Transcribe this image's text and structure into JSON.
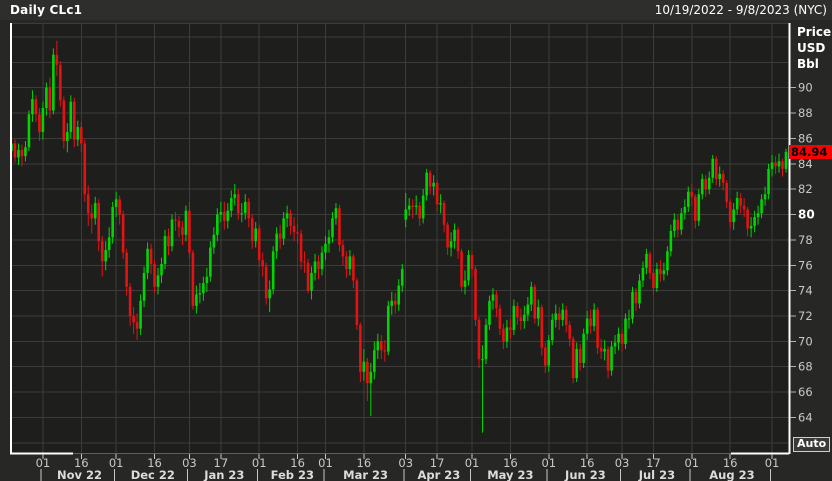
{
  "header": {
    "title": "Daily CLc1",
    "date_range": "10/19/2022 - 9/8/2023 (NYC)"
  },
  "right_axis": {
    "unit_lines": [
      "Price",
      "USD",
      "Bbl"
    ],
    "auto_label": "Auto"
  },
  "chart_data": {
    "type": "candlestick",
    "symbol": "CLc1",
    "interval": "Daily",
    "title": "Daily CLc1",
    "period": "10/19/2022 - 9/8/2023 (NYC)",
    "ylabel": "Price USD Bbl",
    "last_price": 84.94,
    "ylim": [
      61.2,
      95.1
    ],
    "grid_prices": [
      62,
      64,
      66,
      68,
      70,
      72,
      74,
      76,
      78,
      80,
      82,
      84,
      86,
      88,
      90,
      92,
      94
    ],
    "y_labels": [
      90,
      88,
      86,
      84,
      82,
      80,
      78,
      76,
      74,
      72,
      70,
      68,
      66,
      64
    ],
    "y_bold_label": "80",
    "x_ticks": [
      {
        "i": 9,
        "label": "01"
      },
      {
        "i": 20,
        "label": "16"
      },
      {
        "i": 30,
        "label": "01"
      },
      {
        "i": 41,
        "label": "16"
      },
      {
        "i": 51,
        "label": "03"
      },
      {
        "i": 60,
        "label": "17"
      },
      {
        "i": 71,
        "label": "01"
      },
      {
        "i": 82,
        "label": "16"
      },
      {
        "i": 90,
        "label": "01"
      },
      {
        "i": 101,
        "label": "16"
      },
      {
        "i": 113,
        "label": "03"
      },
      {
        "i": 122,
        "label": "17"
      },
      {
        "i": 132,
        "label": "01"
      },
      {
        "i": 143,
        "label": "16"
      },
      {
        "i": 154,
        "label": "01"
      },
      {
        "i": 165,
        "label": "16"
      },
      {
        "i": 175,
        "label": "03"
      },
      {
        "i": 184,
        "label": "17"
      },
      {
        "i": 195,
        "label": "01"
      },
      {
        "i": 206,
        "label": "16"
      },
      {
        "i": 218,
        "label": "01"
      }
    ],
    "month_boundaries": [
      9,
      30,
      51,
      71,
      90,
      113,
      132,
      154,
      175,
      195,
      218
    ],
    "months": [
      {
        "start": 9,
        "end": 30,
        "label": "Nov 22"
      },
      {
        "start": 30,
        "end": 51,
        "label": "Dec 22"
      },
      {
        "start": 51,
        "end": 71,
        "label": "Jan 23"
      },
      {
        "start": 71,
        "end": 90,
        "label": "Feb 23"
      },
      {
        "start": 90,
        "end": 113,
        "label": "Mar 23"
      },
      {
        "start": 113,
        "end": 132,
        "label": "Apr 23"
      },
      {
        "start": 132,
        "end": 154,
        "label": "May 23"
      },
      {
        "start": 154,
        "end": 175,
        "label": "Jun 23"
      },
      {
        "start": 175,
        "end": 195,
        "label": "Jul 23"
      },
      {
        "start": 195,
        "end": 218,
        "label": "Aug 23"
      }
    ],
    "colors": {
      "up": "#00d600",
      "down": "#e41212",
      "badge": "#fa0000",
      "plot_bg": "#1e1e1d",
      "grid": "#3c3c3c",
      "outer_bg": "#272726",
      "axis_label": "#c9c9c9",
      "white": "#ffffff"
    },
    "candles": [
      [
        85.0,
        86.0,
        84.3,
        85.6
      ],
      [
        85.6,
        85.9,
        84.1,
        84.5
      ],
      [
        84.5,
        85.6,
        83.9,
        85.1
      ],
      [
        85.1,
        85.5,
        83.8,
        84.6
      ],
      [
        84.6,
        85.8,
        84.2,
        85.3
      ],
      [
        85.3,
        88.2,
        85.0,
        87.9
      ],
      [
        87.9,
        89.8,
        87.3,
        89.1
      ],
      [
        89.1,
        89.4,
        87.3,
        87.9
      ],
      [
        87.9,
        88.4,
        85.8,
        86.5
      ],
      [
        86.5,
        88.9,
        85.9,
        88.4
      ],
      [
        88.4,
        90.4,
        87.8,
        90.0
      ],
      [
        90.0,
        90.8,
        87.6,
        88.2
      ],
      [
        88.2,
        93.1,
        87.9,
        92.6
      ],
      [
        92.6,
        93.7,
        90.9,
        91.8
      ],
      [
        91.8,
        92.1,
        88.5,
        89.0
      ],
      [
        89.0,
        89.3,
        85.2,
        85.8
      ],
      [
        85.8,
        87.2,
        84.9,
        86.5
      ],
      [
        86.5,
        89.4,
        86.0,
        88.9
      ],
      [
        88.9,
        89.2,
        85.3,
        85.9
      ],
      [
        85.9,
        87.4,
        85.4,
        86.9
      ],
      [
        86.9,
        87.3,
        84.9,
        85.6
      ],
      [
        85.6,
        85.9,
        81.0,
        81.6
      ],
      [
        81.6,
        82.3,
        79.1,
        80.1
      ],
      [
        80.1,
        80.8,
        78.5,
        79.7
      ],
      [
        79.7,
        81.4,
        79.2,
        80.9
      ],
      [
        80.9,
        81.2,
        77.1,
        77.9
      ],
      [
        77.9,
        78.3,
        75.1,
        76.3
      ],
      [
        76.3,
        77.9,
        75.6,
        77.2
      ],
      [
        77.2,
        79.0,
        76.6,
        78.2
      ],
      [
        78.2,
        81.0,
        77.7,
        80.6
      ],
      [
        80.6,
        81.8,
        79.8,
        81.2
      ],
      [
        81.2,
        81.5,
        79.2,
        80.0
      ],
      [
        80.0,
        80.3,
        76.5,
        77.0
      ],
      [
        77.0,
        77.3,
        73.6,
        74.3
      ],
      [
        74.3,
        74.6,
        71.2,
        72.0
      ],
      [
        72.0,
        72.7,
        70.6,
        71.5
      ],
      [
        71.5,
        72.2,
        70.1,
        71.0
      ],
      [
        71.0,
        73.7,
        70.5,
        73.2
      ],
      [
        73.2,
        75.9,
        72.7,
        75.4
      ],
      [
        75.4,
        77.8,
        74.9,
        77.3
      ],
      [
        77.3,
        77.7,
        75.3,
        76.1
      ],
      [
        76.1,
        76.4,
        73.8,
        74.3
      ],
      [
        74.3,
        75.8,
        73.7,
        75.2
      ],
      [
        75.2,
        76.6,
        74.6,
        76.1
      ],
      [
        76.1,
        78.8,
        75.7,
        78.3
      ],
      [
        78.3,
        78.9,
        76.8,
        77.5
      ],
      [
        77.5,
        80.0,
        77.1,
        79.6
      ],
      [
        79.6,
        80.2,
        78.7,
        79.5
      ],
      [
        79.5,
        79.9,
        78.2,
        79.0
      ],
      [
        79.0,
        79.5,
        77.6,
        78.4
      ],
      [
        78.4,
        80.7,
        77.9,
        80.3
      ],
      [
        80.3,
        81.0,
        76.6,
        77.0
      ],
      [
        77.0,
        77.2,
        72.5,
        72.8
      ],
      [
        72.8,
        74.4,
        72.2,
        73.7
      ],
      [
        73.7,
        74.6,
        73.0,
        73.8
      ],
      [
        73.8,
        75.1,
        73.2,
        74.6
      ],
      [
        74.6,
        75.8,
        73.9,
        75.1
      ],
      [
        75.1,
        77.9,
        74.7,
        77.4
      ],
      [
        77.4,
        79.0,
        76.9,
        78.4
      ],
      [
        78.4,
        80.5,
        77.9,
        80.0
      ],
      [
        80.0,
        81.0,
        79.4,
        80.2
      ],
      [
        80.2,
        81.0,
        78.8,
        79.5
      ],
      [
        79.5,
        80.9,
        78.9,
        80.3
      ],
      [
        80.3,
        81.9,
        79.8,
        81.3
      ],
      [
        81.3,
        82.4,
        80.7,
        81.6
      ],
      [
        81.6,
        82.0,
        79.6,
        80.1
      ],
      [
        80.1,
        80.9,
        79.4,
        80.1
      ],
      [
        80.1,
        81.6,
        79.6,
        81.0
      ],
      [
        81.0,
        81.3,
        79.0,
        79.7
      ],
      [
        79.7,
        80.0,
        77.3,
        77.9
      ],
      [
        77.9,
        79.4,
        77.4,
        78.9
      ],
      [
        78.9,
        79.2,
        75.9,
        76.4
      ],
      [
        76.4,
        77.0,
        75.1,
        75.9
      ],
      [
        75.9,
        76.2,
        72.9,
        73.4
      ],
      [
        73.4,
        74.8,
        72.3,
        74.1
      ],
      [
        74.1,
        77.5,
        73.7,
        77.1
      ],
      [
        77.1,
        79.0,
        76.5,
        78.5
      ],
      [
        78.5,
        79.2,
        77.3,
        78.1
      ],
      [
        78.1,
        80.2,
        77.6,
        79.7
      ],
      [
        79.7,
        80.7,
        79.0,
        80.1
      ],
      [
        80.1,
        80.4,
        78.4,
        79.1
      ],
      [
        79.1,
        79.8,
        77.9,
        78.6
      ],
      [
        78.6,
        79.3,
        77.7,
        78.5
      ],
      [
        78.5,
        78.8,
        75.7,
        76.3
      ],
      [
        76.3,
        77.1,
        75.4,
        76.2
      ],
      [
        76.2,
        76.5,
        73.8,
        74.0
      ],
      [
        74.0,
        75.9,
        73.3,
        75.4
      ],
      [
        75.4,
        76.9,
        74.8,
        76.3
      ],
      [
        76.3,
        76.8,
        74.9,
        75.7
      ],
      [
        75.7,
        77.5,
        75.2,
        77.0
      ],
      [
        77.0,
        78.3,
        76.4,
        77.7
      ],
      [
        77.7,
        78.8,
        77.0,
        78.2
      ],
      [
        78.2,
        80.2,
        77.8,
        79.7
      ],
      [
        79.7,
        80.9,
        79.2,
        80.5
      ],
      [
        80.5,
        80.8,
        77.1,
        77.6
      ],
      [
        77.6,
        78.0,
        76.0,
        76.7
      ],
      [
        76.7,
        77.1,
        75.0,
        75.7
      ],
      [
        75.7,
        77.2,
        75.2,
        76.7
      ],
      [
        76.7,
        76.9,
        74.2,
        74.8
      ],
      [
        74.8,
        75.0,
        70.9,
        71.3
      ],
      [
        71.3,
        71.5,
        66.8,
        67.6
      ],
      [
        67.6,
        69.4,
        66.9,
        68.4
      ],
      [
        68.4,
        68.7,
        65.3,
        66.7
      ],
      [
        66.7,
        68.3,
        64.1,
        67.6
      ],
      [
        67.6,
        70.0,
        67.0,
        69.3
      ],
      [
        69.3,
        70.6,
        68.6,
        70.0
      ],
      [
        70.0,
        70.5,
        68.6,
        69.3
      ],
      [
        69.3,
        70.1,
        68.4,
        69.2
      ],
      [
        69.2,
        73.2,
        68.9,
        72.8
      ],
      [
        72.8,
        73.9,
        72.1,
        73.2
      ],
      [
        73.2,
        73.8,
        72.2,
        72.9
      ],
      [
        72.9,
        74.9,
        72.4,
        74.4
      ],
      [
        74.4,
        76.1,
        73.9,
        75.7
      ],
      [
        79.6,
        81.7,
        79.0,
        80.4
      ],
      [
        80.4,
        81.3,
        79.9,
        80.7
      ],
      [
        80.7,
        81.2,
        79.7,
        80.6
      ],
      [
        80.6,
        81.5,
        80.0,
        80.7
      ],
      [
        80.7,
        81.0,
        79.1,
        79.7
      ],
      [
        79.7,
        82.0,
        79.3,
        81.5
      ],
      [
        81.5,
        83.6,
        81.1,
        83.3
      ],
      [
        83.3,
        83.5,
        81.6,
        82.2
      ],
      [
        82.2,
        83.1,
        81.5,
        82.5
      ],
      [
        82.5,
        82.7,
        80.2,
        80.8
      ],
      [
        80.8,
        81.6,
        80.1,
        80.9
      ],
      [
        80.9,
        81.1,
        78.6,
        79.2
      ],
      [
        79.2,
        79.4,
        76.8,
        77.4
      ],
      [
        77.4,
        78.6,
        76.7,
        77.9
      ],
      [
        77.9,
        79.3,
        77.3,
        78.8
      ],
      [
        78.8,
        79.0,
        76.5,
        77.1
      ],
      [
        77.1,
        77.3,
        73.9,
        74.3
      ],
      [
        74.3,
        75.6,
        73.7,
        74.8
      ],
      [
        74.8,
        77.2,
        74.4,
        76.8
      ],
      [
        76.8,
        77.1,
        75.0,
        75.7
      ],
      [
        75.7,
        75.9,
        71.2,
        71.7
      ],
      [
        71.7,
        71.9,
        67.9,
        68.6
      ],
      [
        68.6,
        69.7,
        62.8,
        68.6
      ],
      [
        68.6,
        71.8,
        68.2,
        71.3
      ],
      [
        71.3,
        73.6,
        70.9,
        73.2
      ],
      [
        73.2,
        74.2,
        72.5,
        73.7
      ],
      [
        73.7,
        74.0,
        71.9,
        72.6
      ],
      [
        72.6,
        72.9,
        70.5,
        71.0
      ],
      [
        71.0,
        71.4,
        69.4,
        70.0
      ],
      [
        70.0,
        71.7,
        69.5,
        71.1
      ],
      [
        71.1,
        71.8,
        70.2,
        70.9
      ],
      [
        70.9,
        73.3,
        70.5,
        72.8
      ],
      [
        72.8,
        73.1,
        71.3,
        71.9
      ],
      [
        71.9,
        72.6,
        70.9,
        71.6
      ],
      [
        71.6,
        72.8,
        71.0,
        72.1
      ],
      [
        72.1,
        73.5,
        71.6,
        72.9
      ],
      [
        72.9,
        74.7,
        72.4,
        74.3
      ],
      [
        74.3,
        74.5,
        71.4,
        71.8
      ],
      [
        71.8,
        73.3,
        71.2,
        72.7
      ],
      [
        72.7,
        72.9,
        68.9,
        69.5
      ],
      [
        69.5,
        69.9,
        67.5,
        68.1
      ],
      [
        68.1,
        70.5,
        67.6,
        70.1
      ],
      [
        70.1,
        72.2,
        69.7,
        71.7
      ],
      [
        71.7,
        72.9,
        71.1,
        72.2
      ],
      [
        72.2,
        72.7,
        70.9,
        71.7
      ],
      [
        71.7,
        73.0,
        71.2,
        72.5
      ],
      [
        72.5,
        72.8,
        70.7,
        71.3
      ],
      [
        71.3,
        71.6,
        69.6,
        70.2
      ],
      [
        70.2,
        70.4,
        66.7,
        67.1
      ],
      [
        67.1,
        69.9,
        66.8,
        69.4
      ],
      [
        69.4,
        69.8,
        67.7,
        68.3
      ],
      [
        68.3,
        71.0,
        67.9,
        70.6
      ],
      [
        70.6,
        72.4,
        70.1,
        71.8
      ],
      [
        71.8,
        72.5,
        70.6,
        71.2
      ],
      [
        71.2,
        73.0,
        70.8,
        72.5
      ],
      [
        72.5,
        72.7,
        69.0,
        69.5
      ],
      [
        69.5,
        70.2,
        68.6,
        69.2
      ],
      [
        69.2,
        70.1,
        68.5,
        69.4
      ],
      [
        69.4,
        69.6,
        67.1,
        67.7
      ],
      [
        67.7,
        70.0,
        67.3,
        69.6
      ],
      [
        69.6,
        70.5,
        69.0,
        69.9
      ],
      [
        69.9,
        71.1,
        69.3,
        70.6
      ],
      [
        70.6,
        71.0,
        69.2,
        69.8
      ],
      [
        69.8,
        72.2,
        69.4,
        71.8
      ],
      [
        71.8,
        72.5,
        71.0,
        71.8
      ],
      [
        71.8,
        74.3,
        71.4,
        73.9
      ],
      [
        73.9,
        74.2,
        72.4,
        73.0
      ],
      [
        73.0,
        75.3,
        72.6,
        74.8
      ],
      [
        74.8,
        76.3,
        74.3,
        75.8
      ],
      [
        75.8,
        77.3,
        75.3,
        76.9
      ],
      [
        76.9,
        77.1,
        74.9,
        75.4
      ],
      [
        75.4,
        75.7,
        73.7,
        74.2
      ],
      [
        74.2,
        76.2,
        73.9,
        75.7
      ],
      [
        75.7,
        76.4,
        74.7,
        75.3
      ],
      [
        75.3,
        76.2,
        74.8,
        75.6
      ],
      [
        75.6,
        77.5,
        75.2,
        77.1
      ],
      [
        77.1,
        79.2,
        76.7,
        78.7
      ],
      [
        78.7,
        80.1,
        78.2,
        79.6
      ],
      [
        79.6,
        80.0,
        78.2,
        78.8
      ],
      [
        78.8,
        80.5,
        78.4,
        80.1
      ],
      [
        80.1,
        81.2,
        79.6,
        80.6
      ],
      [
        80.6,
        82.2,
        80.2,
        81.8
      ],
      [
        81.8,
        82.4,
        80.7,
        81.4
      ],
      [
        81.4,
        81.6,
        78.9,
        79.5
      ],
      [
        79.5,
        82.0,
        79.1,
        81.6
      ],
      [
        81.6,
        83.2,
        81.2,
        82.8
      ],
      [
        82.8,
        83.1,
        81.4,
        82.0
      ],
      [
        82.0,
        83.4,
        81.6,
        82.9
      ],
      [
        82.9,
        84.7,
        82.5,
        84.4
      ],
      [
        84.4,
        84.6,
        82.3,
        82.8
      ],
      [
        82.8,
        83.8,
        82.2,
        83.2
      ],
      [
        83.2,
        83.5,
        81.9,
        82.5
      ],
      [
        82.5,
        82.7,
        80.5,
        81.0
      ],
      [
        81.0,
        81.2,
        78.9,
        79.4
      ],
      [
        79.4,
        80.9,
        78.8,
        80.4
      ],
      [
        80.4,
        81.8,
        80.0,
        81.3
      ],
      [
        81.3,
        81.7,
        80.1,
        80.7
      ],
      [
        80.7,
        81.3,
        79.8,
        80.4
      ],
      [
        80.4,
        80.6,
        78.3,
        78.9
      ],
      [
        78.9,
        79.8,
        78.2,
        79.1
      ],
      [
        79.1,
        80.3,
        78.6,
        79.8
      ],
      [
        79.8,
        80.7,
        79.2,
        80.1
      ],
      [
        80.1,
        81.6,
        79.7,
        81.2
      ],
      [
        81.2,
        82.2,
        80.7,
        81.6
      ],
      [
        81.6,
        84.0,
        81.2,
        83.6
      ],
      [
        83.6,
        84.7,
        83.0,
        84.1
      ],
      [
        84.1,
        84.6,
        83.2,
        83.8
      ],
      [
        83.8,
        84.8,
        83.3,
        84.2
      ],
      [
        84.2,
        84.4,
        83.0,
        83.6
      ],
      [
        83.6,
        85.2,
        83.3,
        84.94
      ]
    ]
  }
}
